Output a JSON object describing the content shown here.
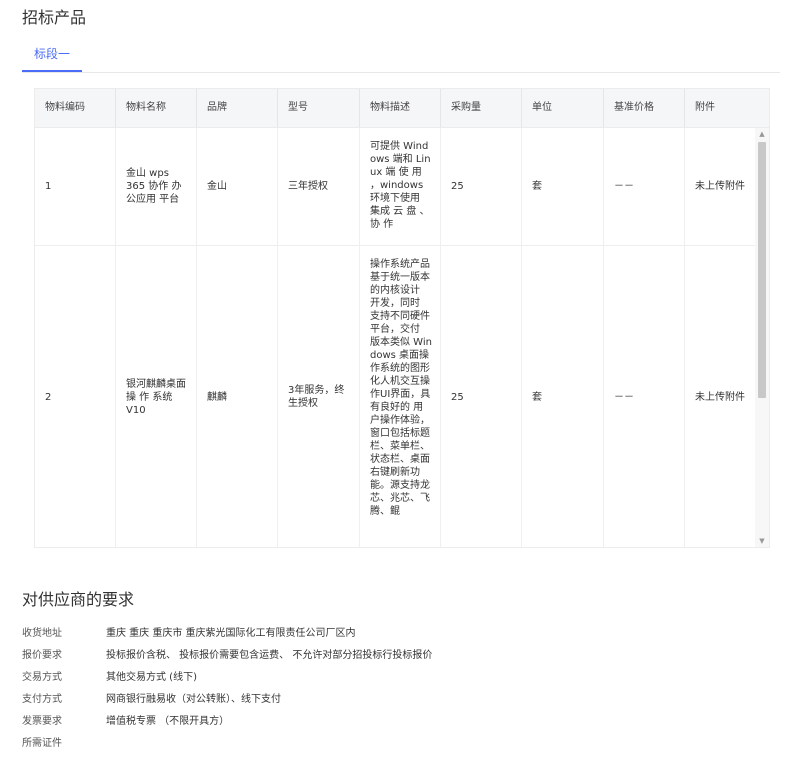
{
  "section_title": "招标产品",
  "tabs": [
    {
      "label": "标段一",
      "active": true
    }
  ],
  "table": {
    "columns": [
      "物料编码",
      "物料名称",
      "品牌",
      "型号",
      "物料描述",
      "采购量",
      "单位",
      "基准价格",
      "附件"
    ],
    "rows": [
      {
        "code": "1",
        "name": "金山 wps 365 协作 办公应用 平台",
        "brand": "金山",
        "model": "三年授权",
        "description": "可提供 Windows 端和 Linux 端 使 用 ，windows 环境下使用 集成 云 盘 、协 作",
        "quantity": "25",
        "unit": "套",
        "base_price": "－－",
        "attachment": "未上传附件"
      },
      {
        "code": "2",
        "name": "银河麒麟桌面 操 作 系统 V10",
        "brand": "麒麟",
        "model": "3年服务，终生授权",
        "description": "操作系统产品基于统一版本的内核设计 开发，同时 支持不同硬件平台，交付 版本类似 Windows 桌面操作系统的图形化人机交互操作UI界面，具有良好的 用户操作体验，窗口包括标题栏、菜单栏、状态栏、桌面右键刷新功能。源支持龙芯、兆芯、飞腾、鲲",
        "quantity": "25",
        "unit": "套",
        "base_price": "－－",
        "attachment": "未上传附件"
      }
    ]
  },
  "requirements": {
    "title": "对供应商的要求",
    "items": [
      {
        "label": "收货地址",
        "value": "重庆 重庆 重庆市 重庆紫光国际化工有限责任公司厂区内"
      },
      {
        "label": "报价要求",
        "value": "投标报价含税、 投标报价需要包含运费、 不允许对部分招投标行投标报价"
      },
      {
        "label": "交易方式",
        "value": "其他交易方式 (线下)"
      },
      {
        "label": "支付方式",
        "value": "网商银行融易收（对公转账）、线下支付"
      },
      {
        "label": "发票要求",
        "value": "增值税专票 （不限开具方）"
      },
      {
        "label": "所需证件",
        "value": ""
      }
    ]
  },
  "icons": {
    "scroll_up": "triangle-up-icon",
    "scroll_down": "triangle-down-icon"
  },
  "colors": {
    "accent": "#4a6cf7",
    "header_bg": "#f5f6f8"
  }
}
